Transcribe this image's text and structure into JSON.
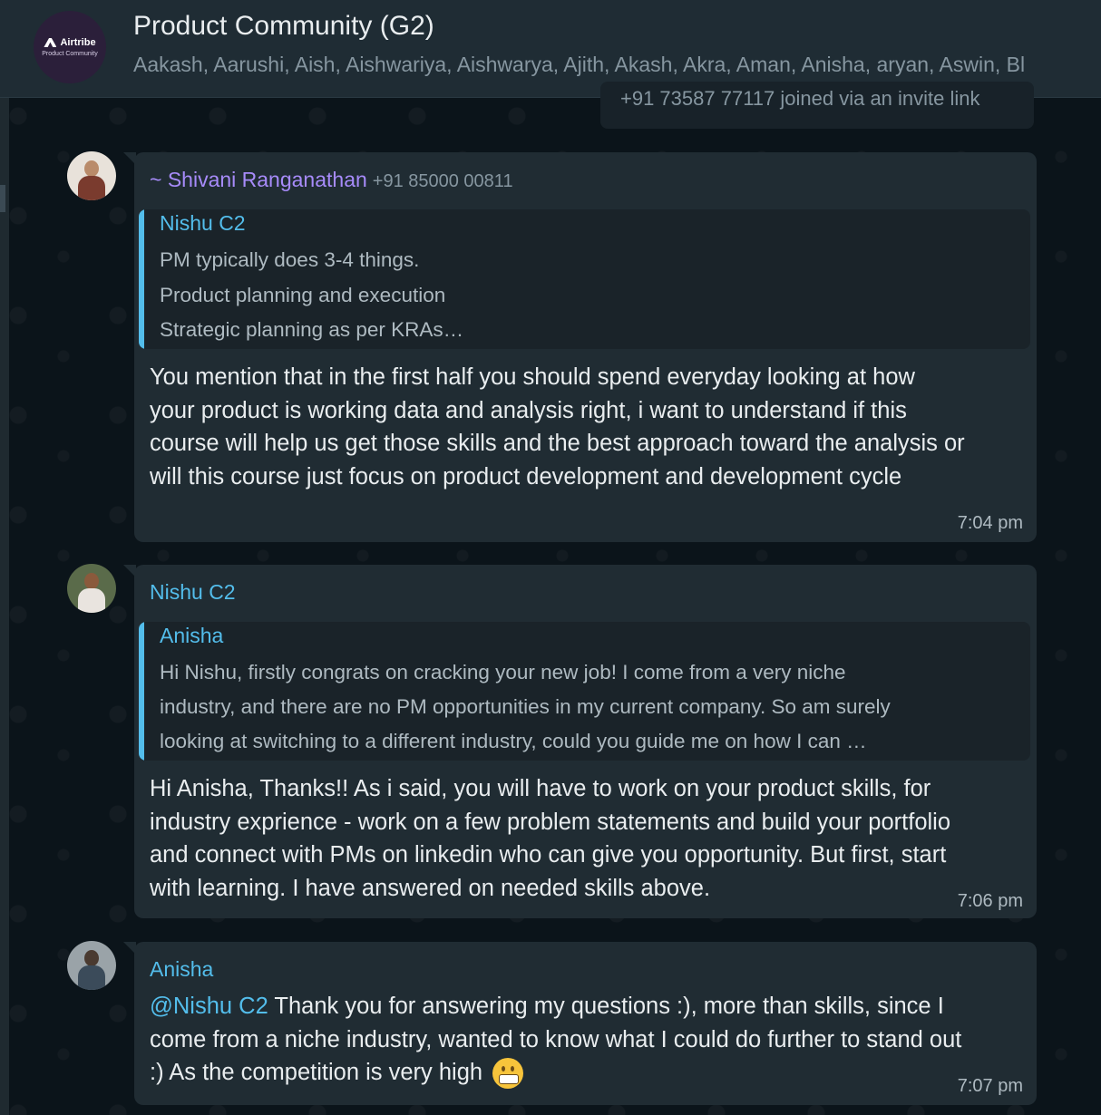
{
  "header": {
    "group_title": "Product Community (G2)",
    "members": "Aakash, Aarushi, Aish, Aishwariya, Aishwarya, Ajith, Akash, Akra, Aman, Anisha, aryan, Aswin, Bl",
    "avatar": {
      "brand": "Airtribe",
      "tagline": "Product Community"
    }
  },
  "system_message": "+91 73587 77117 joined via an invite link",
  "messages": [
    {
      "sender": "~ Shivani Ranganathan",
      "sender_phone": "+91 85000 00811",
      "sender_color": "#a78bfa",
      "quote": {
        "author": "Nishu C2",
        "lines": [
          "PM typically does 3-4 things.",
          "Product planning and execution",
          "Strategic planning as per KRAs…"
        ]
      },
      "lines": [
        "You mention that in the first half you should spend everyday looking at how",
        "your product is working data and analysis right, i want to understand if this",
        "course will help us get those skills and the best approach toward the analysis or",
        "will this course just focus on product development and development cycle"
      ],
      "time": "7:04 pm"
    },
    {
      "sender": "Nishu C2",
      "sender_color": "#53bdeb",
      "quote": {
        "author": "Anisha",
        "lines": [
          "Hi Nishu, firstly congrats on cracking your new job! I come from a very niche",
          "industry, and there are no PM opportunities in my current company. So am surely",
          "looking at switching to a different industry, could you guide me on how I can …"
        ]
      },
      "lines": [
        "Hi Anisha, Thanks!! As i said, you will have to work on your product skills, for",
        "industry exprience - work on a few problem statements and build your portfolio",
        "and connect with PMs on linkedin who can give you opportunity. But first, start",
        "with learning. I have answered on needed skills above."
      ],
      "time": "7:06 pm"
    },
    {
      "sender": "Anisha",
      "sender_color": "#53bdeb",
      "mention": "@Nishu C2",
      "line1_rest": " Thank you for answering my questions :), more than skills, since I",
      "lines": [
        "come from a niche industry, wanted to know what I could do further to stand out",
        ":) As the competition is very high"
      ],
      "emoji": "grimacing-face",
      "time": "7:07 pm"
    }
  ]
}
